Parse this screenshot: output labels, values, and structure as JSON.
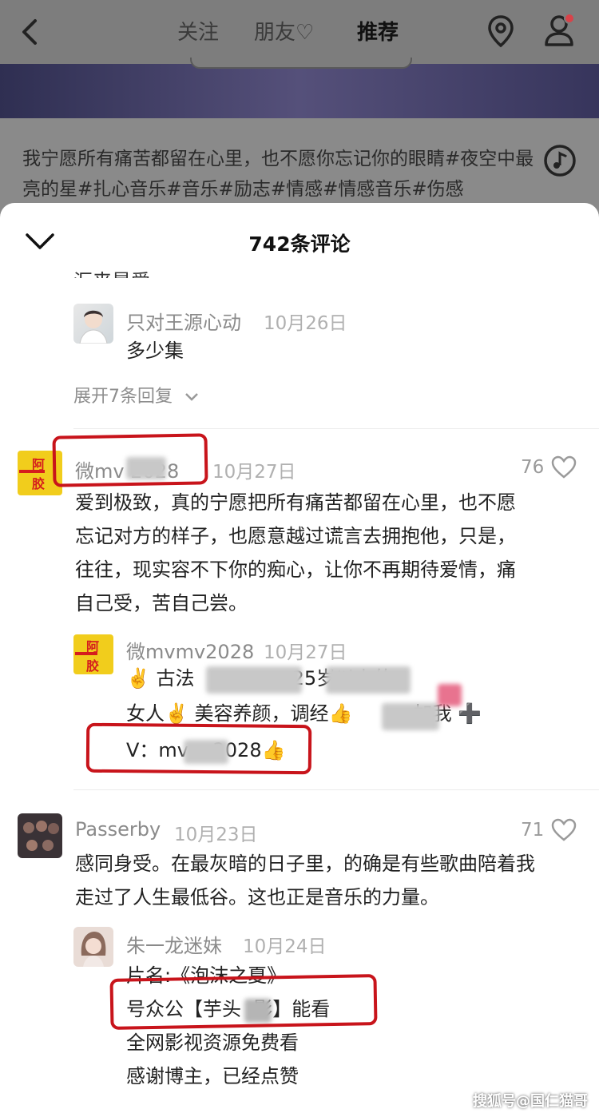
{
  "topbar": {
    "tabs": [
      {
        "label": "关注"
      },
      {
        "label": "朋友♡"
      },
      {
        "label": "推荐"
      }
    ]
  },
  "video": {
    "caption": "我宁愿所有痛苦都留在心里，也不愿你忘记你的眼睛#夜空中最亮的星#扎心音乐#音乐#励志#情感#情感音乐#伤感"
  },
  "sheet": {
    "title": "742条评论",
    "cut_text": "汇来是爱",
    "comments": [
      {
        "name": "只对王源心动",
        "date": "10月26日",
        "text": "多少集",
        "expand": "展开7条回复"
      },
      {
        "name": "微mv  2028",
        "date": "10月27日",
        "likes": "76",
        "text": "爱到极致，真的宁愿把所有痛苦都留在心里，也不愿忘记对方的样子，也愿意越过谎言去拥抱他，只是，往往，现实容不下你的痴心，让你不再期待爱情，痛自己受，苦自己尝。",
        "reply": {
          "name": "微mvmv2028",
          "date": "10月27日",
          "line1": "✌️ 古法                25岁以上的",
          "line2": "女人✌️ 美容养颜，调经👍          加我 ➕",
          "line3": "V：mv    2028👍"
        }
      },
      {
        "name": "Passerby",
        "date": "10月23日",
        "likes": "71",
        "text": "感同身受。在最灰暗的日子里，的确是有些歌曲陪着我走过了人生最低谷。这也正是音乐的力量。",
        "reply": {
          "name": "朱一龙迷妹",
          "date": "10月24日",
          "line1": "片名:《泡沫之夏》",
          "line2": "号众公【芋头  影】能看",
          "line3": "全网影视资源免费看",
          "line4": "感谢博主，已经点赞"
        }
      }
    ],
    "avatar_labels": {
      "top": "阿",
      "bottom": "胶"
    }
  },
  "watermark": "搜狐号@国仁猫哥",
  "colors": {
    "accent_red": "#c8141b",
    "dim_bg": "#7d7d7d",
    "name_gray": "#8a8a8a"
  }
}
